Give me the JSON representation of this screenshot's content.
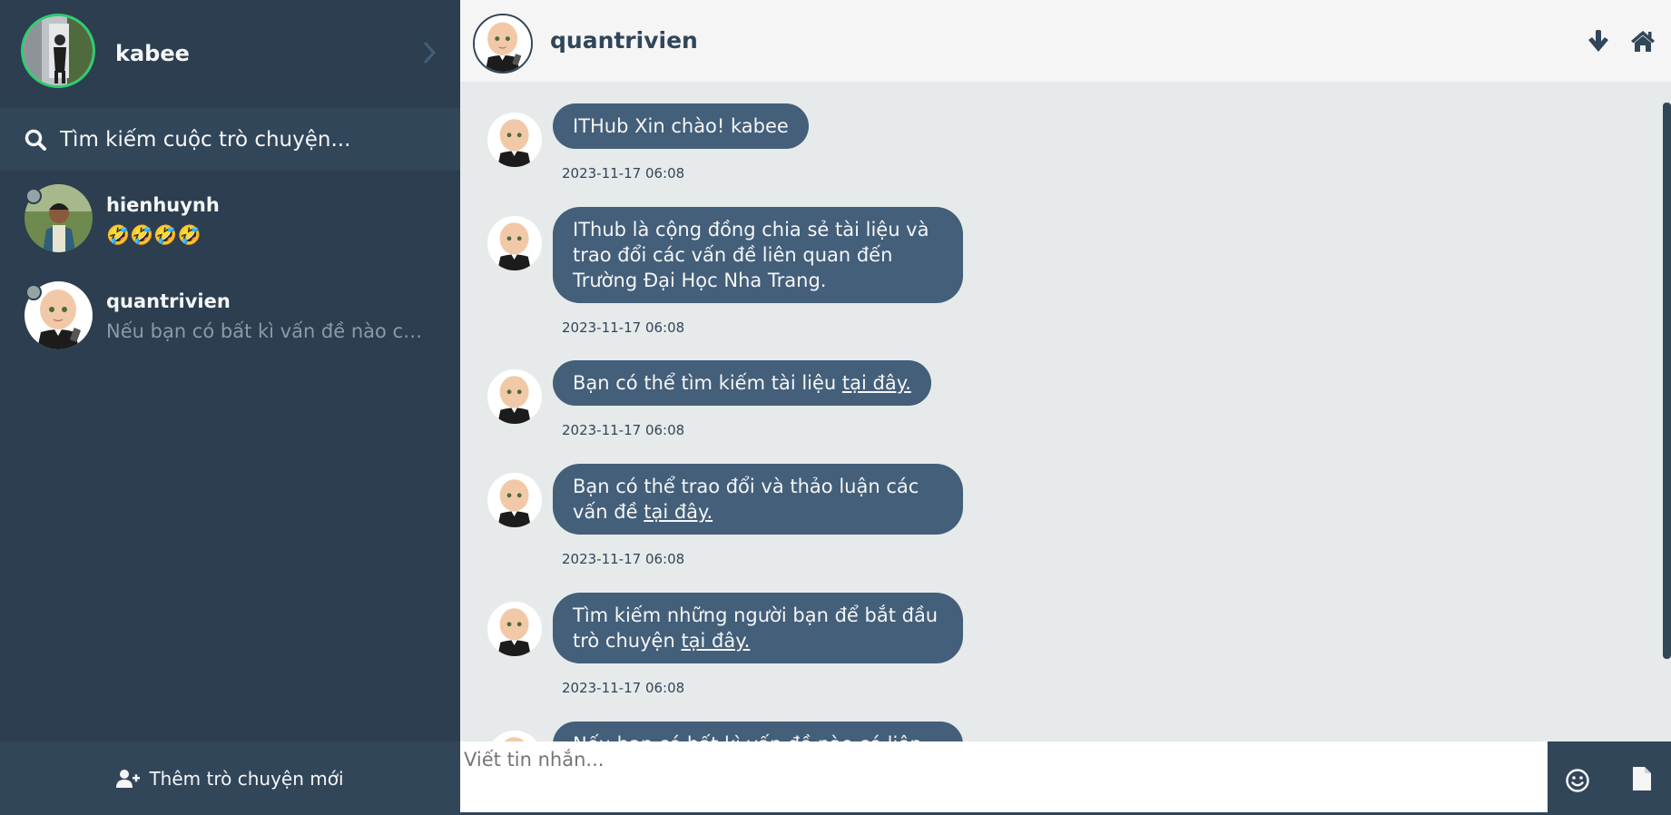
{
  "profile": {
    "name": "kabee"
  },
  "search": {
    "placeholder": "Tìm kiếm cuộc trò chuyện..."
  },
  "contacts": [
    {
      "name": "hienhuynh",
      "preview": "🤣🤣🤣🤣",
      "status": "offline"
    },
    {
      "name": "quantrivien",
      "preview": "Nếu bạn có bất kì vấn đề nào có liên hệ với chúng tôi",
      "status": "offline"
    }
  ],
  "sidebar_footer": {
    "add_label": "Thêm trò chuyện mới"
  },
  "chat": {
    "contact_name": "quantrivien",
    "messages": [
      {
        "text": "ITHub Xin chào! kabee",
        "time": "2023-11-17 06:08"
      },
      {
        "text": "IThub là cộng đồng chia sẻ tài liệu và trao đổi các vấn đề liên quan đến Trường Đại Học Nha Trang.",
        "time": "2023-11-17 06:08"
      },
      {
        "text": "Bạn có thể tìm kiếm tài liệu ",
        "link": "tại đây.",
        "time": "2023-11-17 06:08"
      },
      {
        "text": "Bạn có thể trao đổi và thảo luận các vấn đề ",
        "link": "tại đây.",
        "time": "2023-11-17 06:08"
      },
      {
        "text": "Tìm kiếm những người bạn để bắt đầu trò chuyện ",
        "link": "tại đây.",
        "time": "2023-11-17 06:08"
      },
      {
        "text": "Nếu bạn có bất kì vấn đề nào có liên"
      }
    ]
  },
  "composer": {
    "placeholder": "Viết tin nhắn..."
  },
  "icons": {
    "chevron": "chevron-right-icon",
    "search": "search-icon",
    "add_user": "user-plus-icon",
    "down": "arrow-down-icon",
    "home": "home-icon",
    "emoji": "smile-icon",
    "file": "file-icon"
  },
  "colors": {
    "sidebar_bg": "#2c3e50",
    "sidebar_panel": "#32465a",
    "bubble": "#435f7a",
    "chat_bg": "#e6eaea",
    "online_ring": "#2ecc71",
    "status_offline": "#95a5a6"
  }
}
